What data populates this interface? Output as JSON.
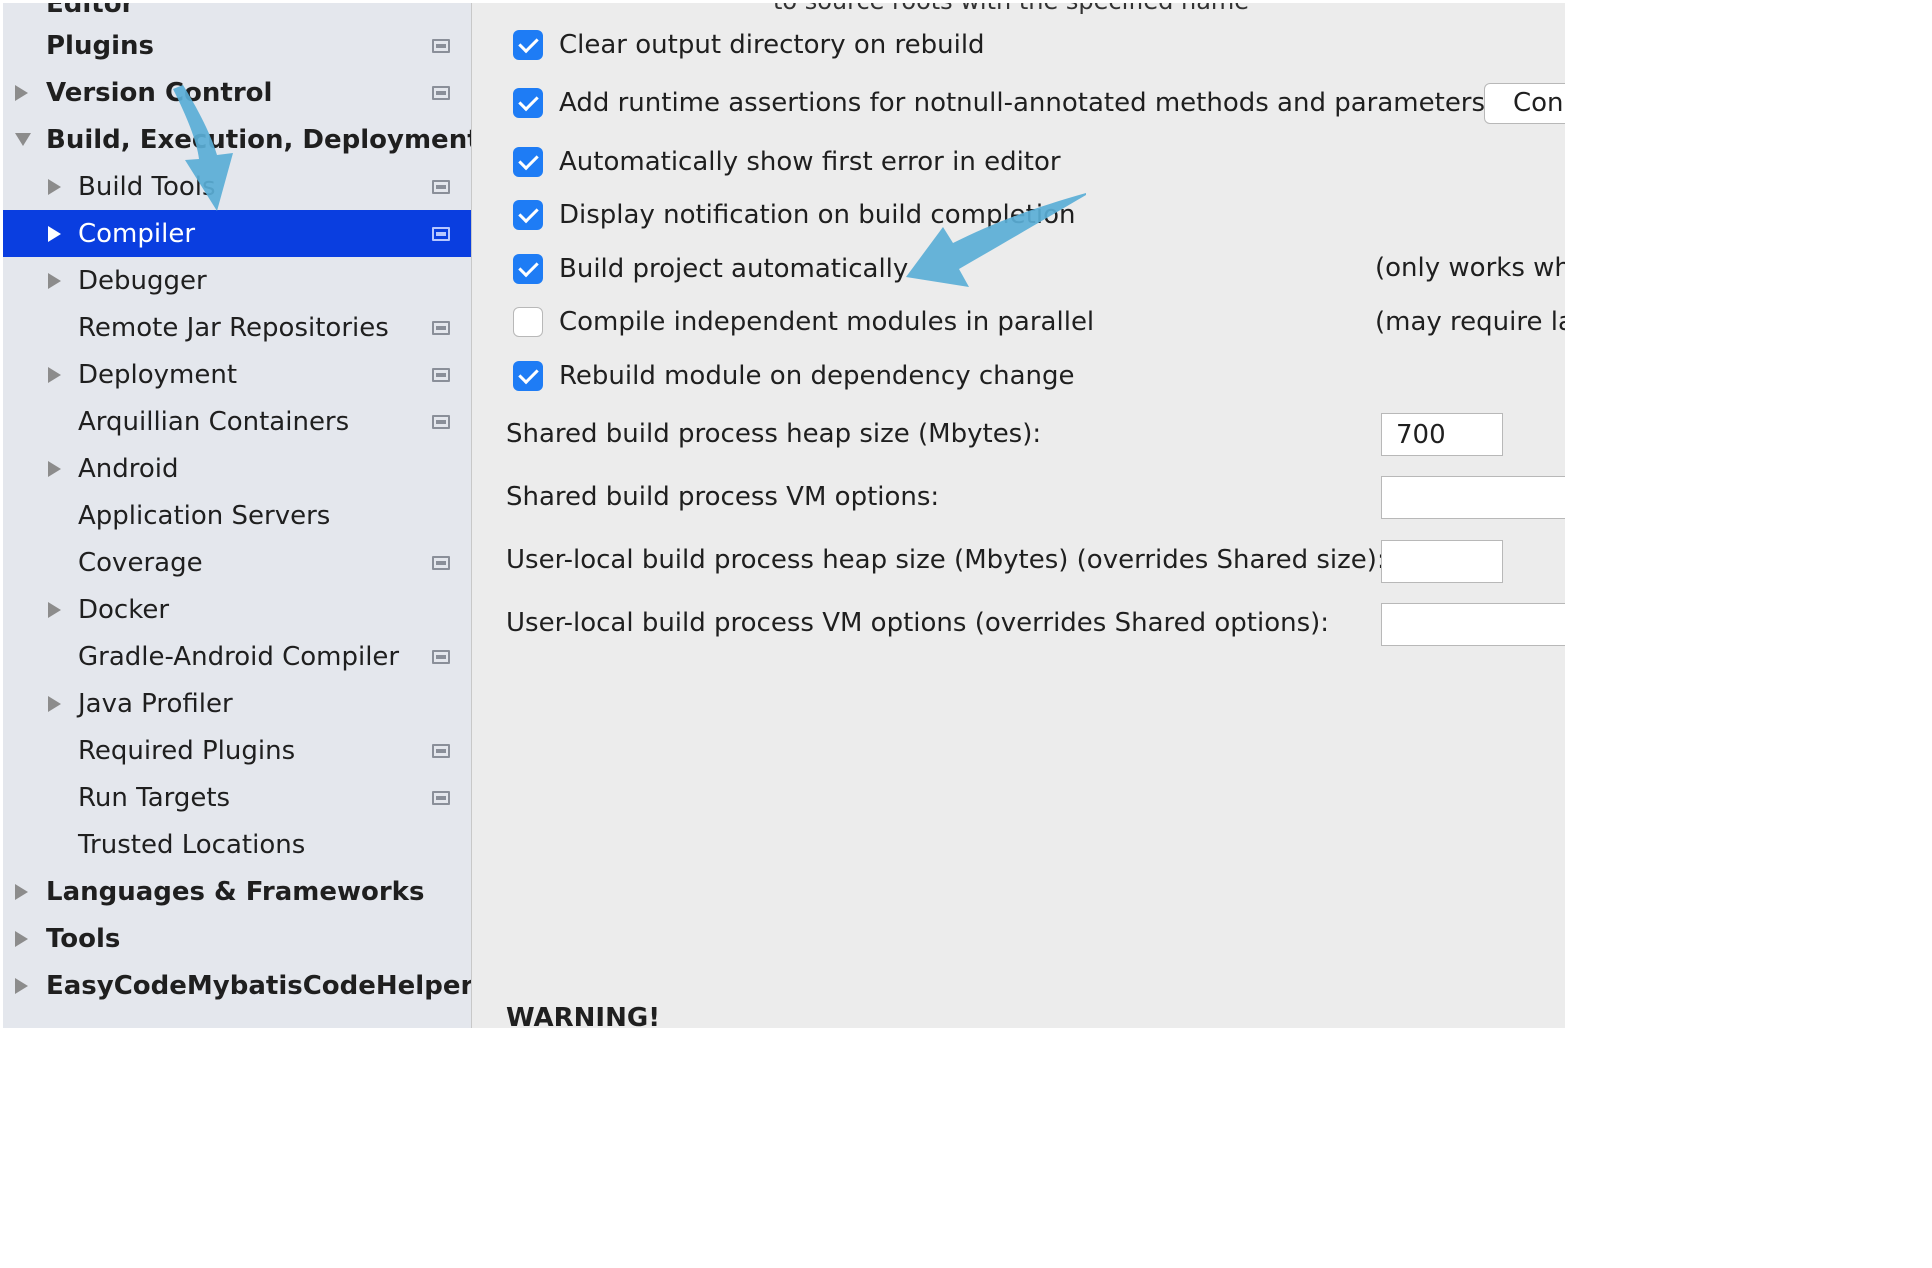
{
  "sidebar": {
    "clipped_top_label": "Editor",
    "items": [
      {
        "label": "Plugins",
        "level": 0,
        "expander": "none",
        "bold": true,
        "project_icon": true
      },
      {
        "label": "Version Control",
        "level": 0,
        "expander": "collapsed",
        "bold": true,
        "project_icon": true
      },
      {
        "label": "Build, Execution, Deployment",
        "level": 0,
        "expander": "expanded",
        "bold": true,
        "project_icon": false
      },
      {
        "label": "Build Tools",
        "level": 1,
        "expander": "collapsed",
        "bold": false,
        "project_icon": true
      },
      {
        "label": "Compiler",
        "level": 1,
        "expander": "collapsed",
        "bold": false,
        "project_icon": true,
        "selected": true
      },
      {
        "label": "Debugger",
        "level": 1,
        "expander": "collapsed",
        "bold": false,
        "project_icon": false
      },
      {
        "label": "Remote Jar Repositories",
        "level": 1,
        "expander": "none",
        "bold": false,
        "project_icon": true
      },
      {
        "label": "Deployment",
        "level": 1,
        "expander": "collapsed",
        "bold": false,
        "project_icon": true
      },
      {
        "label": "Arquillian Containers",
        "level": 1,
        "expander": "none",
        "bold": false,
        "project_icon": true
      },
      {
        "label": "Android",
        "level": 1,
        "expander": "collapsed",
        "bold": false,
        "project_icon": false
      },
      {
        "label": "Application Servers",
        "level": 1,
        "expander": "none",
        "bold": false,
        "project_icon": false
      },
      {
        "label": "Coverage",
        "level": 1,
        "expander": "none",
        "bold": false,
        "project_icon": true
      },
      {
        "label": "Docker",
        "level": 1,
        "expander": "collapsed",
        "bold": false,
        "project_icon": false
      },
      {
        "label": "Gradle-Android Compiler",
        "level": 1,
        "expander": "none",
        "bold": false,
        "project_icon": true
      },
      {
        "label": "Java Profiler",
        "level": 1,
        "expander": "collapsed",
        "bold": false,
        "project_icon": false
      },
      {
        "label": "Required Plugins",
        "level": 1,
        "expander": "none",
        "bold": false,
        "project_icon": true
      },
      {
        "label": "Run Targets",
        "level": 1,
        "expander": "none",
        "bold": false,
        "project_icon": true
      },
      {
        "label": "Trusted Locations",
        "level": 1,
        "expander": "none",
        "bold": false,
        "project_icon": false
      },
      {
        "label": "Languages & Frameworks",
        "level": 0,
        "expander": "collapsed",
        "bold": true,
        "project_icon": false
      },
      {
        "label": "Tools",
        "level": 0,
        "expander": "collapsed",
        "bold": true,
        "project_icon": false
      },
      {
        "label": "EasyCodeMybatisCodeHelperP",
        "level": 0,
        "expander": "collapsed",
        "bold": true,
        "project_icon": false
      }
    ]
  },
  "main": {
    "clipped_top_text": "to source roots with the specified name",
    "options": [
      {
        "label": "Clear output directory on rebuild",
        "checked": true,
        "note": ""
      },
      {
        "label": "Add runtime assertions for notnull-annotated methods and parameters",
        "checked": true,
        "note": ""
      },
      {
        "label": "Automatically show first error in editor",
        "checked": true,
        "note": ""
      },
      {
        "label": "Display notification on build completion",
        "checked": true,
        "note": ""
      },
      {
        "label": "Build project automatically",
        "checked": true,
        "note": "(only works wh"
      },
      {
        "label": "Compile independent modules in parallel",
        "checked": false,
        "note": "(may require la"
      },
      {
        "label": "Rebuild module on dependency change",
        "checked": true,
        "note": ""
      }
    ],
    "configure_button_label": "Con",
    "fields": [
      {
        "label": "Shared build process heap size (Mbytes):",
        "value": "700"
      },
      {
        "label": "Shared build process VM options:",
        "value": ""
      },
      {
        "label": "User-local build process heap size (Mbytes) (overrides Shared size):",
        "value": ""
      },
      {
        "label": "User-local build process VM options (overrides Shared options):",
        "value": ""
      }
    ],
    "warning_label": "WARNING!"
  },
  "colors": {
    "selection": "#0a3ee0",
    "checkbox_accent": "#1e7cf5",
    "annotation_arrow": "#5aaed6"
  }
}
